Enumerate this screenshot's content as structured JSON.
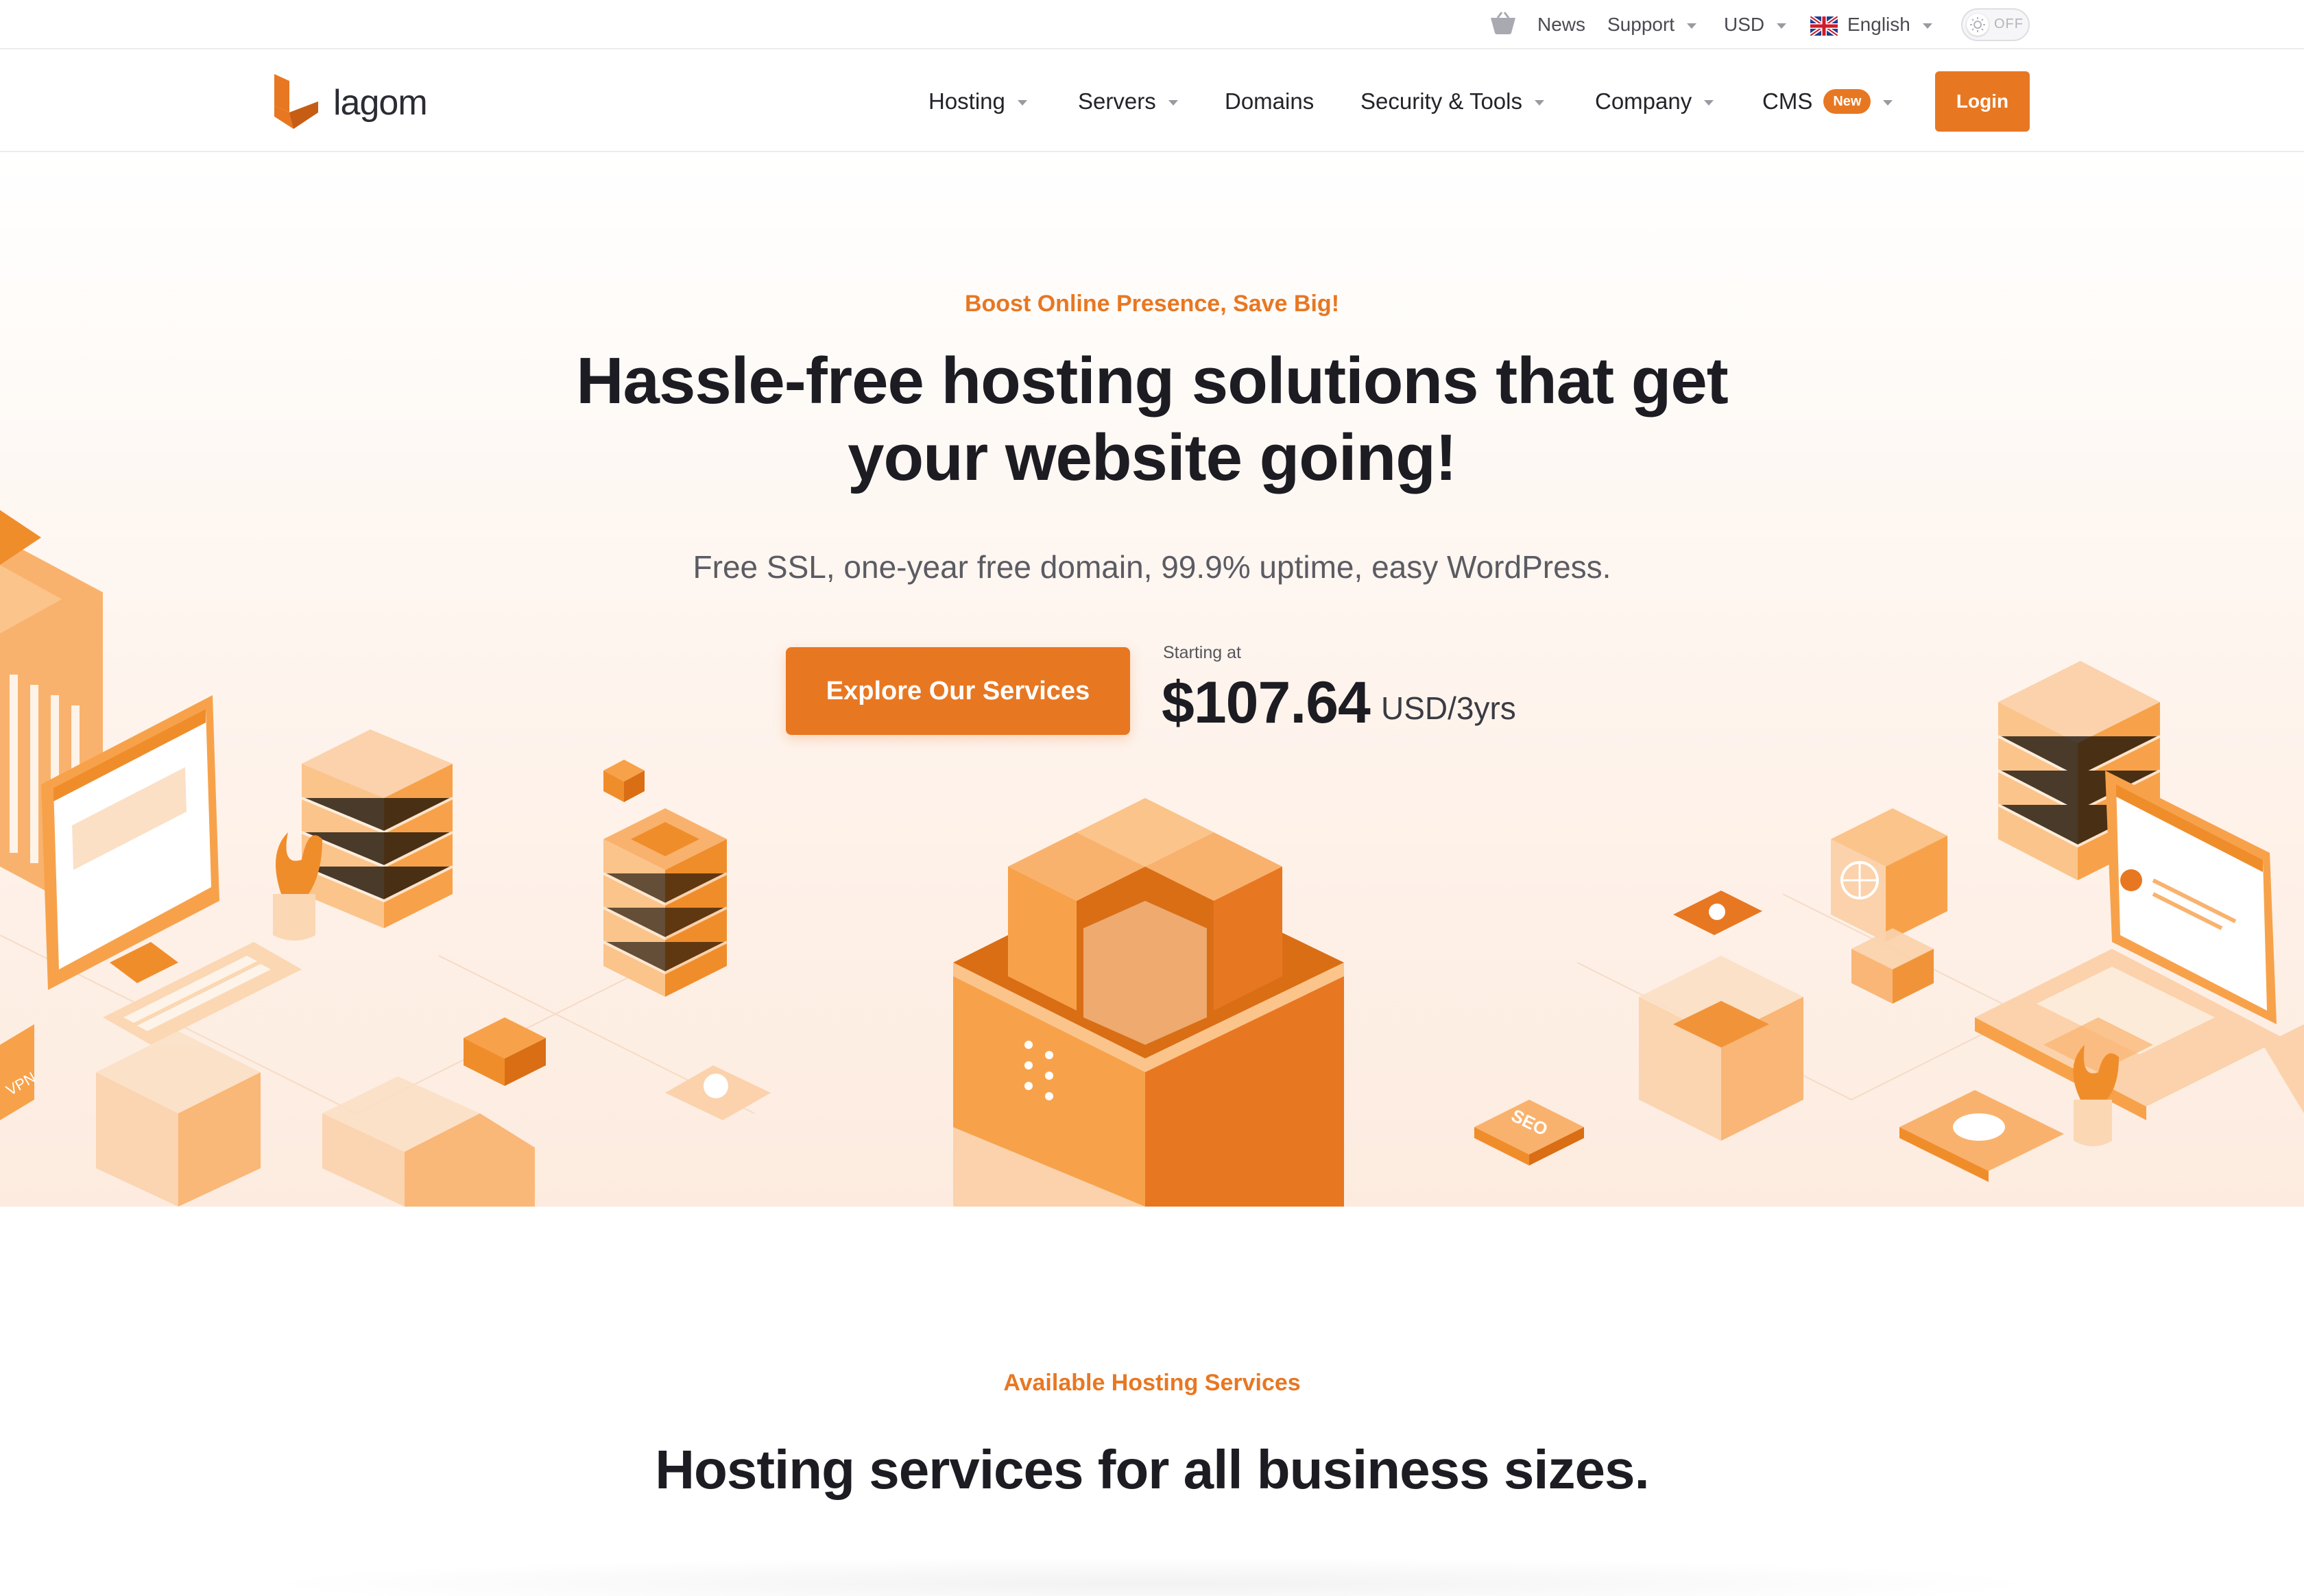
{
  "utility_bar": {
    "news": "News",
    "support": "Support",
    "currency": "USD",
    "language": "English",
    "theme_toggle": "OFF"
  },
  "nav": {
    "logo_text": "lagom",
    "items": [
      {
        "label": "Hosting",
        "has_dropdown": true
      },
      {
        "label": "Servers",
        "has_dropdown": true
      },
      {
        "label": "Domains",
        "has_dropdown": false
      },
      {
        "label": "Security & Tools",
        "has_dropdown": true
      },
      {
        "label": "Company",
        "has_dropdown": true
      },
      {
        "label": "CMS",
        "has_dropdown": true,
        "badge": "New"
      }
    ],
    "login": "Login"
  },
  "hero": {
    "eyebrow": "Boost Online Presence, Save Big!",
    "title": "Hassle-free hosting solutions that get your website going!",
    "subtitle": "Free SSL, one-year free domain, 99.9% uptime, easy WordPress.",
    "cta": "Explore Our Services",
    "price_label": "Starting at",
    "price_amount": "$107.64",
    "price_unit": "USD/3yrs",
    "illustration_labels": {
      "seo": "SEO",
      "vpn": "VPN"
    }
  },
  "services": {
    "eyebrow": "Available Hosting Services",
    "title": "Hosting services for all business sizes."
  },
  "colors": {
    "accent": "#e87722",
    "accent_light": "#f9b26d",
    "accent_pale": "#fbd7b4",
    "text_dark": "#1c1c22",
    "text_muted": "#5b5b63"
  }
}
